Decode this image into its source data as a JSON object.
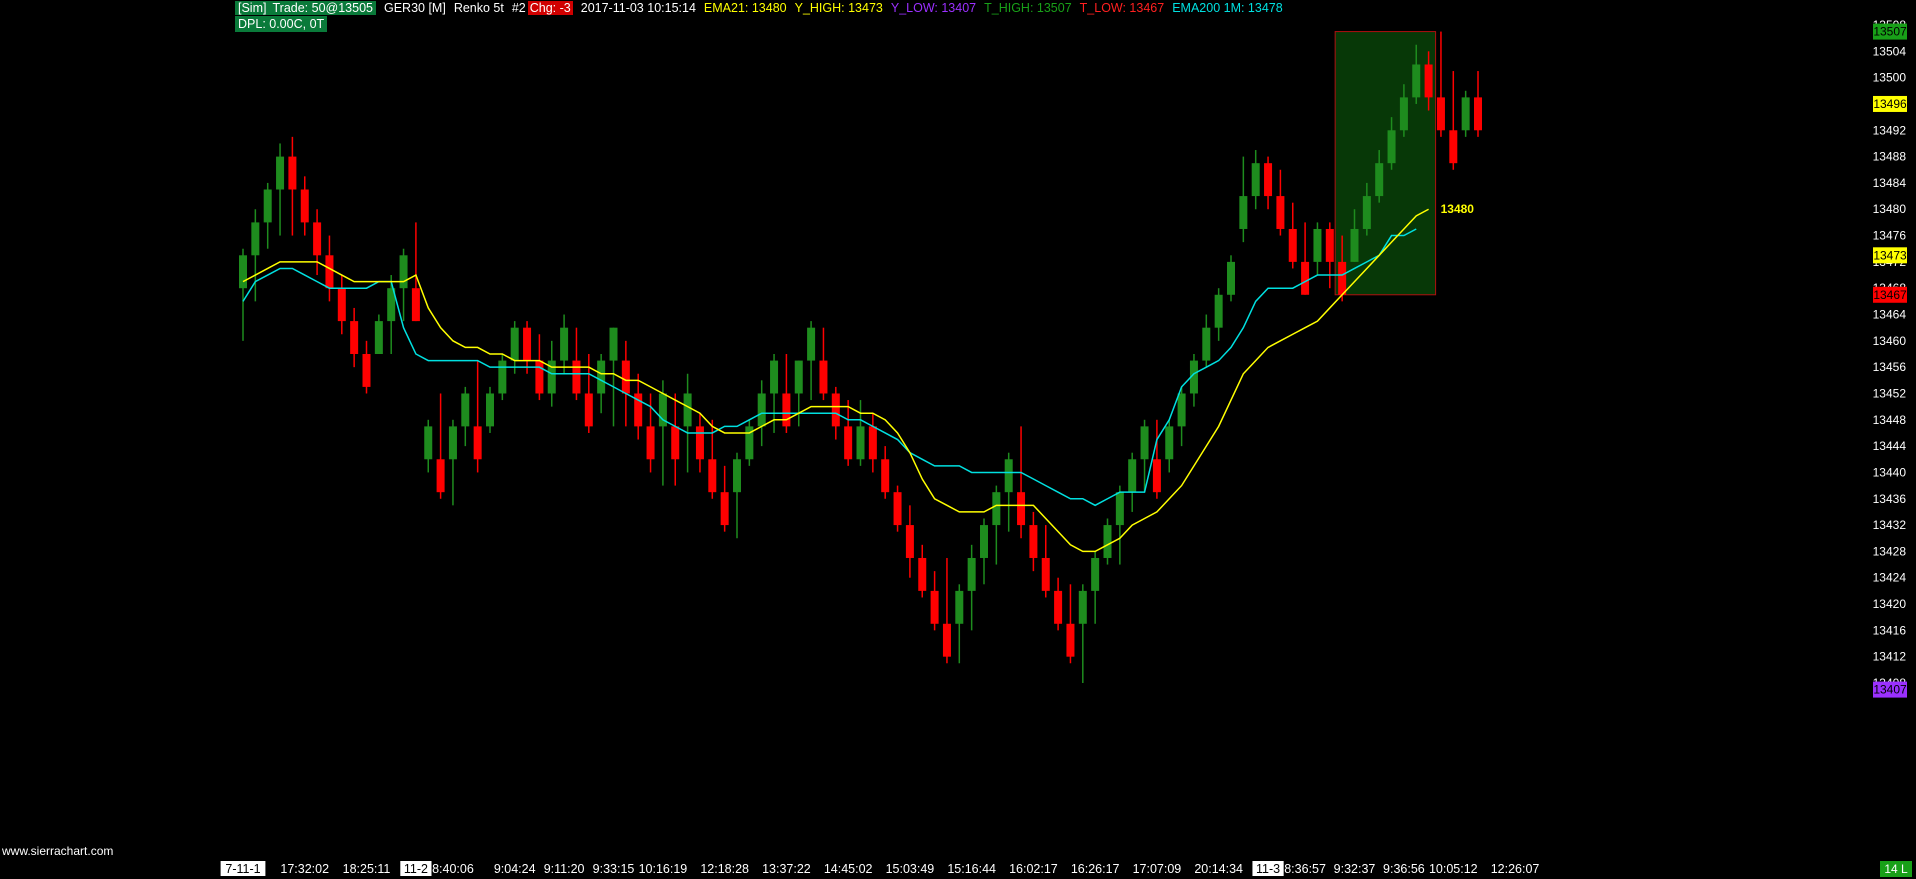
{
  "header": {
    "sim_label": "[Sim]",
    "trade": "Trade: 50@13505",
    "symbol": "GER30 [M]",
    "chart_type": "Renko 5t",
    "chart_number": "#2",
    "chg": "Chg: -3",
    "timestamp": "2017-11-03 10:15:14",
    "ema21": "EMA21: 13480",
    "y_high": "Y_HIGH: 13473",
    "y_low": "Y_LOW: 13407",
    "t_high": "T_HIGH: 13507",
    "t_low": "T_LOW: 13467",
    "ema200": "EMA200 1M: 13478",
    "dpl": "DPL: 0.00C, 0T"
  },
  "colors": {
    "up": "#1e8c1e",
    "down": "#ff0000",
    "ema21": "#ffff00",
    "ema200": "#00e0e0",
    "y_high": "#ffff00",
    "y_low": "#9b30ff",
    "t_high": "#18a018",
    "t_low": "#ff2020",
    "box_fill": "#073807",
    "box_border": "#b01010"
  },
  "watermark": "www.sierrachart.com",
  "chart_data": {
    "type": "candlestick",
    "ylim": [
      13407,
      13508
    ],
    "y_ticks": [
      13508,
      13504,
      13500,
      13496,
      13492,
      13488,
      13484,
      13480,
      13476,
      13472,
      13468,
      13464,
      13460,
      13456,
      13452,
      13448,
      13444,
      13440,
      13436,
      13432,
      13428,
      13424,
      13420,
      13416,
      13412,
      13408
    ],
    "price_markers": [
      {
        "label": "13507",
        "value": 13507,
        "color": "#18a018",
        "text": "#000"
      },
      {
        "label": "13496",
        "value": 13496,
        "color": "#ffff00",
        "text": "#000"
      },
      {
        "label": "13473",
        "value": 13473,
        "color": "#ffff00",
        "text": "#000"
      },
      {
        "label": "13467",
        "value": 13467,
        "color": "#ff0000",
        "text": "#000"
      },
      {
        "label": "13407",
        "value": 13407,
        "color": "#9b30ff",
        "text": "#000"
      }
    ],
    "ema21_label": "13480",
    "x_labels": [
      {
        "bar": 0,
        "text": "7-11-1",
        "boxed": true
      },
      {
        "bar": 5,
        "text": "17:32:02"
      },
      {
        "bar": 10,
        "text": "18:25:11"
      },
      {
        "bar": 14,
        "text": "11-2",
        "boxed": true
      },
      {
        "bar": 17,
        "text": "8:40:06"
      },
      {
        "bar": 22,
        "text": "9:04:24"
      },
      {
        "bar": 26,
        "text": "9:11:20"
      },
      {
        "bar": 30,
        "text": "9:33:15"
      },
      {
        "bar": 34,
        "text": "10:16:19"
      },
      {
        "bar": 39,
        "text": "12:18:28"
      },
      {
        "bar": 44,
        "text": "13:37:22"
      },
      {
        "bar": 49,
        "text": "14:45:02"
      },
      {
        "bar": 54,
        "text": "15:03:49"
      },
      {
        "bar": 59,
        "text": "15:16:44"
      },
      {
        "bar": 64,
        "text": "16:02:17"
      },
      {
        "bar": 69,
        "text": "16:26:17"
      },
      {
        "bar": 74,
        "text": "17:07:09"
      },
      {
        "bar": 79,
        "text": "20:14:34"
      },
      {
        "bar": 83,
        "text": "11-3",
        "boxed": true
      },
      {
        "bar": 86,
        "text": "8:36:57"
      },
      {
        "bar": 90,
        "text": "9:32:37"
      },
      {
        "bar": 94,
        "text": "9:36:56"
      },
      {
        "bar": 98,
        "text": "10:05:12"
      },
      {
        "bar": 103,
        "text": "12:26:07"
      }
    ],
    "corner_label": "14 L",
    "bars": [
      {
        "o": 13468,
        "c": 13473,
        "h": 13474,
        "l": 13460
      },
      {
        "o": 13473,
        "c": 13478,
        "h": 13480,
        "l": 13466
      },
      {
        "o": 13478,
        "c": 13483,
        "h": 13484,
        "l": 13474
      },
      {
        "o": 13483,
        "c": 13488,
        "h": 13490,
        "l": 13476
      },
      {
        "o": 13488,
        "c": 13483,
        "h": 13491,
        "l": 13476
      },
      {
        "o": 13483,
        "c": 13478,
        "h": 13485,
        "l": 13476
      },
      {
        "o": 13478,
        "c": 13473,
        "h": 13480,
        "l": 13470
      },
      {
        "o": 13473,
        "c": 13468,
        "h": 13476,
        "l": 13466
      },
      {
        "o": 13468,
        "c": 13463,
        "h": 13470,
        "l": 13461
      },
      {
        "o": 13463,
        "c": 13458,
        "h": 13465,
        "l": 13456
      },
      {
        "o": 13458,
        "c": 13453,
        "h": 13460,
        "l": 13452
      },
      {
        "o": 13458,
        "c": 13463,
        "h": 13464,
        "l": 13458
      },
      {
        "o": 13463,
        "c": 13468,
        "h": 13470,
        "l": 13458
      },
      {
        "o": 13468,
        "c": 13473,
        "h": 13474,
        "l": 13463
      },
      {
        "o": 13468,
        "c": 13463,
        "h": 13478,
        "l": 13463
      },
      {
        "o": 13442,
        "c": 13447,
        "h": 13448,
        "l": 13440
      },
      {
        "o": 13442,
        "c": 13437,
        "h": 13452,
        "l": 13436
      },
      {
        "o": 13442,
        "c": 13447,
        "h": 13448,
        "l": 13435
      },
      {
        "o": 13447,
        "c": 13452,
        "h": 13453,
        "l": 13444
      },
      {
        "o": 13447,
        "c": 13442,
        "h": 13457,
        "l": 13440
      },
      {
        "o": 13447,
        "c": 13452,
        "h": 13453,
        "l": 13446
      },
      {
        "o": 13452,
        "c": 13457,
        "h": 13458,
        "l": 13451
      },
      {
        "o": 13457,
        "c": 13462,
        "h": 13463,
        "l": 13455
      },
      {
        "o": 13462,
        "c": 13457,
        "h": 13463,
        "l": 13455
      },
      {
        "o": 13457,
        "c": 13452,
        "h": 13461,
        "l": 13451
      },
      {
        "o": 13452,
        "c": 13457,
        "h": 13460,
        "l": 13450
      },
      {
        "o": 13457,
        "c": 13462,
        "h": 13464,
        "l": 13455
      },
      {
        "o": 13457,
        "c": 13452,
        "h": 13462,
        "l": 13451
      },
      {
        "o": 13452,
        "c": 13447,
        "h": 13458,
        "l": 13446
      },
      {
        "o": 13452,
        "c": 13457,
        "h": 13458,
        "l": 13449
      },
      {
        "o": 13457,
        "c": 13462,
        "h": 13462,
        "l": 13447
      },
      {
        "o": 13457,
        "c": 13452,
        "h": 13460,
        "l": 13447
      },
      {
        "o": 13452,
        "c": 13447,
        "h": 13455,
        "l": 13445
      },
      {
        "o": 13447,
        "c": 13442,
        "h": 13452,
        "l": 13440
      },
      {
        "o": 13447,
        "c": 13452,
        "h": 13454,
        "l": 13438
      },
      {
        "o": 13447,
        "c": 13442,
        "h": 13452,
        "l": 13438
      },
      {
        "o": 13447,
        "c": 13452,
        "h": 13455,
        "l": 13440
      },
      {
        "o": 13447,
        "c": 13442,
        "h": 13449,
        "l": 13440
      },
      {
        "o": 13442,
        "c": 13437,
        "h": 13448,
        "l": 13436
      },
      {
        "o": 13437,
        "c": 13432,
        "h": 13441,
        "l": 13431
      },
      {
        "o": 13437,
        "c": 13442,
        "h": 13443,
        "l": 13430
      },
      {
        "o": 13442,
        "c": 13447,
        "h": 13448,
        "l": 13441
      },
      {
        "o": 13447,
        "c": 13452,
        "h": 13454,
        "l": 13444
      },
      {
        "o": 13452,
        "c": 13457,
        "h": 13458,
        "l": 13446
      },
      {
        "o": 13452,
        "c": 13447,
        "h": 13458,
        "l": 13446
      },
      {
        "o": 13452,
        "c": 13457,
        "h": 13457,
        "l": 13447
      },
      {
        "o": 13457,
        "c": 13462,
        "h": 13463,
        "l": 13451
      },
      {
        "o": 13457,
        "c": 13452,
        "h": 13462,
        "l": 13451
      },
      {
        "o": 13452,
        "c": 13447,
        "h": 13453,
        "l": 13445
      },
      {
        "o": 13447,
        "c": 13442,
        "h": 13451,
        "l": 13441
      },
      {
        "o": 13442,
        "c": 13447,
        "h": 13451,
        "l": 13441
      },
      {
        "o": 13447,
        "c": 13442,
        "h": 13449,
        "l": 13440
      },
      {
        "o": 13442,
        "c": 13437,
        "h": 13444,
        "l": 13436
      },
      {
        "o": 13437,
        "c": 13432,
        "h": 13438,
        "l": 13431
      },
      {
        "o": 13432,
        "c": 13427,
        "h": 13435,
        "l": 13424
      },
      {
        "o": 13427,
        "c": 13422,
        "h": 13429,
        "l": 13421
      },
      {
        "o": 13422,
        "c": 13417,
        "h": 13425,
        "l": 13416
      },
      {
        "o": 13417,
        "c": 13412,
        "h": 13427,
        "l": 13411
      },
      {
        "o": 13417,
        "c": 13422,
        "h": 13423,
        "l": 13411
      },
      {
        "o": 13422,
        "c": 13427,
        "h": 13429,
        "l": 13416
      },
      {
        "o": 13427,
        "c": 13432,
        "h": 13433,
        "l": 13423
      },
      {
        "o": 13432,
        "c": 13437,
        "h": 13438,
        "l": 13426
      },
      {
        "o": 13437,
        "c": 13442,
        "h": 13443,
        "l": 13431
      },
      {
        "o": 13437,
        "c": 13432,
        "h": 13447,
        "l": 13430
      },
      {
        "o": 13432,
        "c": 13427,
        "h": 13434,
        "l": 13425
      },
      {
        "o": 13427,
        "c": 13422,
        "h": 13432,
        "l": 13421
      },
      {
        "o": 13422,
        "c": 13417,
        "h": 13424,
        "l": 13416
      },
      {
        "o": 13417,
        "c": 13412,
        "h": 13423,
        "l": 13411
      },
      {
        "o": 13417,
        "c": 13422,
        "h": 13423,
        "l": 13408
      },
      {
        "o": 13422,
        "c": 13427,
        "h": 13428,
        "l": 13417
      },
      {
        "o": 13427,
        "c": 13432,
        "h": 13433,
        "l": 13426
      },
      {
        "o": 13432,
        "c": 13437,
        "h": 13438,
        "l": 13426
      },
      {
        "o": 13437,
        "c": 13442,
        "h": 13443,
        "l": 13434
      },
      {
        "o": 13442,
        "c": 13447,
        "h": 13448,
        "l": 13437
      },
      {
        "o": 13442,
        "c": 13437,
        "h": 13448,
        "l": 13436
      },
      {
        "o": 13442,
        "c": 13447,
        "h": 13448,
        "l": 13440
      },
      {
        "o": 13447,
        "c": 13452,
        "h": 13453,
        "l": 13444
      },
      {
        "o": 13452,
        "c": 13457,
        "h": 13458,
        "l": 13450
      },
      {
        "o": 13457,
        "c": 13462,
        "h": 13464,
        "l": 13456
      },
      {
        "o": 13462,
        "c": 13467,
        "h": 13468,
        "l": 13460
      },
      {
        "o": 13467,
        "c": 13472,
        "h": 13473,
        "l": 13466
      },
      {
        "o": 13477,
        "c": 13482,
        "h": 13488,
        "l": 13475
      },
      {
        "o": 13482,
        "c": 13487,
        "h": 13489,
        "l": 13480
      },
      {
        "o": 13487,
        "c": 13482,
        "h": 13488,
        "l": 13480
      },
      {
        "o": 13482,
        "c": 13477,
        "h": 13486,
        "l": 13476
      },
      {
        "o": 13477,
        "c": 13472,
        "h": 13481,
        "l": 13471
      },
      {
        "o": 13472,
        "c": 13467,
        "h": 13478,
        "l": 13467
      },
      {
        "o": 13472,
        "c": 13477,
        "h": 13478,
        "l": 13470
      },
      {
        "o": 13477,
        "c": 13472,
        "h": 13478,
        "l": 13468
      },
      {
        "o": 13472,
        "c": 13467,
        "h": 13476,
        "l": 13466
      },
      {
        "o": 13472,
        "c": 13477,
        "h": 13480,
        "l": 13472
      },
      {
        "o": 13477,
        "c": 13482,
        "h": 13484,
        "l": 13476
      },
      {
        "o": 13482,
        "c": 13487,
        "h": 13489,
        "l": 13481
      },
      {
        "o": 13487,
        "c": 13492,
        "h": 13494,
        "l": 13486
      },
      {
        "o": 13492,
        "c": 13497,
        "h": 13499,
        "l": 13491
      },
      {
        "o": 13497,
        "c": 13502,
        "h": 13505,
        "l": 13496
      },
      {
        "o": 13502,
        "c": 13497,
        "h": 13504,
        "l": 13495
      },
      {
        "o": 13497,
        "c": 13492,
        "h": 13507,
        "l": 13491
      },
      {
        "o": 13492,
        "c": 13487,
        "h": 13501,
        "l": 13486
      },
      {
        "o": 13492,
        "c": 13497,
        "h": 13498,
        "l": 13491
      },
      {
        "o": 13497,
        "c": 13492,
        "h": 13501,
        "l": 13491
      }
    ],
    "ema21": [
      13469,
      13470,
      13471,
      13472,
      13472,
      13472,
      13472,
      13471,
      13470,
      13469,
      13469,
      13469,
      13469,
      13469,
      13470,
      13465,
      13462,
      13460,
      13459,
      13459,
      13458,
      13458,
      13457,
      13457,
      13457,
      13456,
      13456,
      13456,
      13456,
      13455,
      13455,
      13454,
      13454,
      13453,
      13452,
      13451,
      13450,
      13449,
      13447,
      13446,
      13446,
      13446,
      13447,
      13448,
      13448,
      13449,
      13450,
      13450,
      13450,
      13450,
      13449,
      13449,
      13448,
      13446,
      13443,
      13439,
      13436,
      13435,
      13434,
      13434,
      13434,
      13435,
      13435,
      13435,
      13435,
      13433,
      13431,
      13429,
      13428,
      13428,
      13429,
      13430,
      13432,
      13433,
      13434,
      13436,
      13438,
      13441,
      13444,
      13447,
      13451,
      13455,
      13457,
      13459,
      13460,
      13461,
      13462,
      13463,
      13465,
      13467,
      13469,
      13471,
      13473,
      13475,
      13477,
      13479,
      13480
    ],
    "ema200": [
      13466,
      13469,
      13470,
      13471,
      13471,
      13470,
      13469,
      13468,
      13468,
      13468,
      13468,
      13469,
      13469,
      13462,
      13458,
      13457,
      13457,
      13457,
      13457,
      13457,
      13456,
      13456,
      13456,
      13456,
      13456,
      13455,
      13455,
      13455,
      13455,
      13454,
      13453,
      13452,
      13451,
      13450,
      13448,
      13447,
      13446,
      13446,
      13446,
      13447,
      13447,
      13448,
      13449,
      13449,
      13449,
      13449,
      13449,
      13449,
      13449,
      13448,
      13448,
      13447,
      13446,
      13445,
      13443,
      13442,
      13441,
      13441,
      13441,
      13440,
      13440,
      13440,
      13440,
      13440,
      13439,
      13438,
      13437,
      13436,
      13436,
      13435,
      13436,
      13437,
      13437,
      13437,
      13445,
      13448,
      13453,
      13455,
      13456,
      13457,
      13459,
      13462,
      13466,
      13468,
      13468,
      13468,
      13469,
      13470,
      13470,
      13470,
      13471,
      13472,
      13473,
      13476,
      13476,
      13477
    ]
  }
}
